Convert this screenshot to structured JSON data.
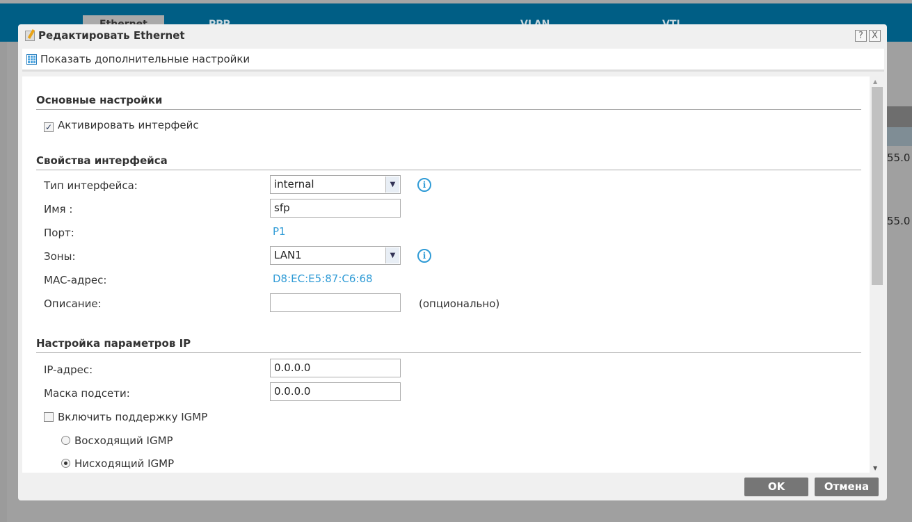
{
  "background": {
    "tabs": [
      "Ethernet",
      "PPP",
      "VLAN",
      "VTI"
    ],
    "cells": [
      "55.0",
      "55.0"
    ]
  },
  "dialog": {
    "title": "Редактировать Ethernet",
    "help_label": "?",
    "close_label": "X",
    "toolbar": {
      "advanced_label": "Показать дополнительные настройки"
    },
    "basic": {
      "heading": "Основные настройки",
      "activate_label": "Активировать интерфейс",
      "activate_checked": true
    },
    "props": {
      "heading": "Свойства интерфейса",
      "type_label": "Тип интерфейса:",
      "type_value": "internal",
      "name_label": "Имя :",
      "name_value": "sfp",
      "port_label": "Порт:",
      "port_value": "P1",
      "zone_label": "Зоны:",
      "zone_value": "LAN1",
      "mac_label": "MAC-адрес:",
      "mac_value": "D8:EC:E5:87:C6:68",
      "desc_label": "Описание:",
      "desc_value": "",
      "desc_hint": "(опционально)"
    },
    "ip": {
      "heading": "Настройка параметров IP",
      "ip_label": "IP-адрес:",
      "ip_value": "0.0.0.0",
      "mask_label": "Маска подсети:",
      "mask_value": "0.0.0.0",
      "igmp_label": "Включить поддержку IGMP",
      "igmp_checked": false,
      "upstream_label": "Восходящий IGMP",
      "downstream_label": "Нисходящий IGMP",
      "selected": "downstream"
    },
    "ok_label": "OK",
    "cancel_label": "Отмена"
  }
}
